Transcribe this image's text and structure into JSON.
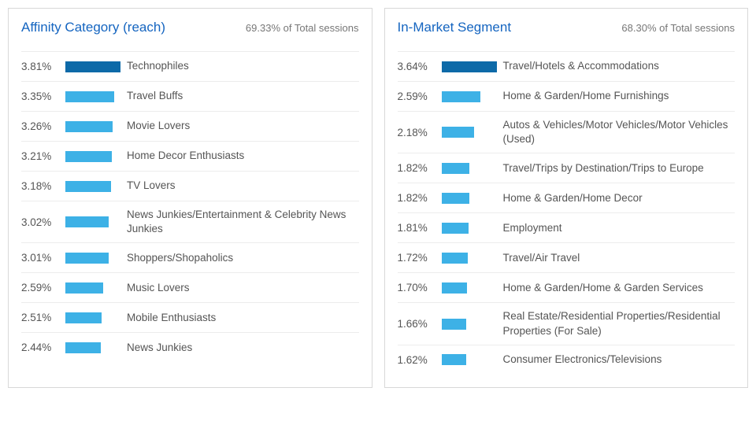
{
  "panels": [
    {
      "title": "Affinity Category (reach)",
      "subtitle": "69.33% of Total sessions",
      "max_value": 3.81,
      "rows": [
        {
          "pct": "3.81%",
          "value": 3.81,
          "label": "Technophiles"
        },
        {
          "pct": "3.35%",
          "value": 3.35,
          "label": "Travel Buffs"
        },
        {
          "pct": "3.26%",
          "value": 3.26,
          "label": "Movie Lovers"
        },
        {
          "pct": "3.21%",
          "value": 3.21,
          "label": "Home Decor Enthusiasts"
        },
        {
          "pct": "3.18%",
          "value": 3.18,
          "label": "TV Lovers"
        },
        {
          "pct": "3.02%",
          "value": 3.02,
          "label": "News Junkies/Entertainment & Celebrity News Junkies"
        },
        {
          "pct": "3.01%",
          "value": 3.01,
          "label": "Shoppers/Shopaholics"
        },
        {
          "pct": "2.59%",
          "value": 2.59,
          "label": "Music Lovers"
        },
        {
          "pct": "2.51%",
          "value": 2.51,
          "label": "Mobile Enthusiasts"
        },
        {
          "pct": "2.44%",
          "value": 2.44,
          "label": "News Junkies"
        }
      ]
    },
    {
      "title": "In-Market Segment",
      "subtitle": "68.30% of Total sessions",
      "max_value": 3.64,
      "rows": [
        {
          "pct": "3.64%",
          "value": 3.64,
          "label": "Travel/Hotels & Accommodations"
        },
        {
          "pct": "2.59%",
          "value": 2.59,
          "label": "Home & Garden/Home Furnishings"
        },
        {
          "pct": "2.18%",
          "value": 2.18,
          "label": "Autos & Vehicles/Motor Vehicles/Motor Vehicles (Used)"
        },
        {
          "pct": "1.82%",
          "value": 1.82,
          "label": "Travel/Trips by Destination/Trips to Europe"
        },
        {
          "pct": "1.82%",
          "value": 1.82,
          "label": "Home & Garden/Home Decor"
        },
        {
          "pct": "1.81%",
          "value": 1.81,
          "label": "Employment"
        },
        {
          "pct": "1.72%",
          "value": 1.72,
          "label": "Travel/Air Travel"
        },
        {
          "pct": "1.70%",
          "value": 1.7,
          "label": "Home & Garden/Home & Garden Services"
        },
        {
          "pct": "1.66%",
          "value": 1.66,
          "label": "Real Estate/Residential Properties/Residential Properties (For Sale)"
        },
        {
          "pct": "1.62%",
          "value": 1.62,
          "label": "Consumer Electronics/Televisions"
        }
      ]
    }
  ],
  "chart_data": [
    {
      "type": "bar",
      "title": "Affinity Category (reach)",
      "subtitle": "69.33% of Total sessions",
      "xlabel": "% of Total sessions",
      "ylabel": "",
      "categories": [
        "Technophiles",
        "Travel Buffs",
        "Movie Lovers",
        "Home Decor Enthusiasts",
        "TV Lovers",
        "News Junkies/Entertainment & Celebrity News Junkies",
        "Shoppers/Shopaholics",
        "Music Lovers",
        "Mobile Enthusiasts",
        "News Junkies"
      ],
      "values": [
        3.81,
        3.35,
        3.26,
        3.21,
        3.18,
        3.02,
        3.01,
        2.59,
        2.51,
        2.44
      ],
      "ylim": [
        0,
        3.81
      ]
    },
    {
      "type": "bar",
      "title": "In-Market Segment",
      "subtitle": "68.30% of Total sessions",
      "xlabel": "% of Total sessions",
      "ylabel": "",
      "categories": [
        "Travel/Hotels & Accommodations",
        "Home & Garden/Home Furnishings",
        "Autos & Vehicles/Motor Vehicles/Motor Vehicles (Used)",
        "Travel/Trips by Destination/Trips to Europe",
        "Home & Garden/Home Decor",
        "Employment",
        "Travel/Air Travel",
        "Home & Garden/Home & Garden Services",
        "Real Estate/Residential Properties/Residential Properties (For Sale)",
        "Consumer Electronics/Televisions"
      ],
      "values": [
        3.64,
        2.59,
        2.18,
        1.82,
        1.82,
        1.81,
        1.72,
        1.7,
        1.66,
        1.62
      ],
      "ylim": [
        0,
        3.64
      ]
    }
  ]
}
